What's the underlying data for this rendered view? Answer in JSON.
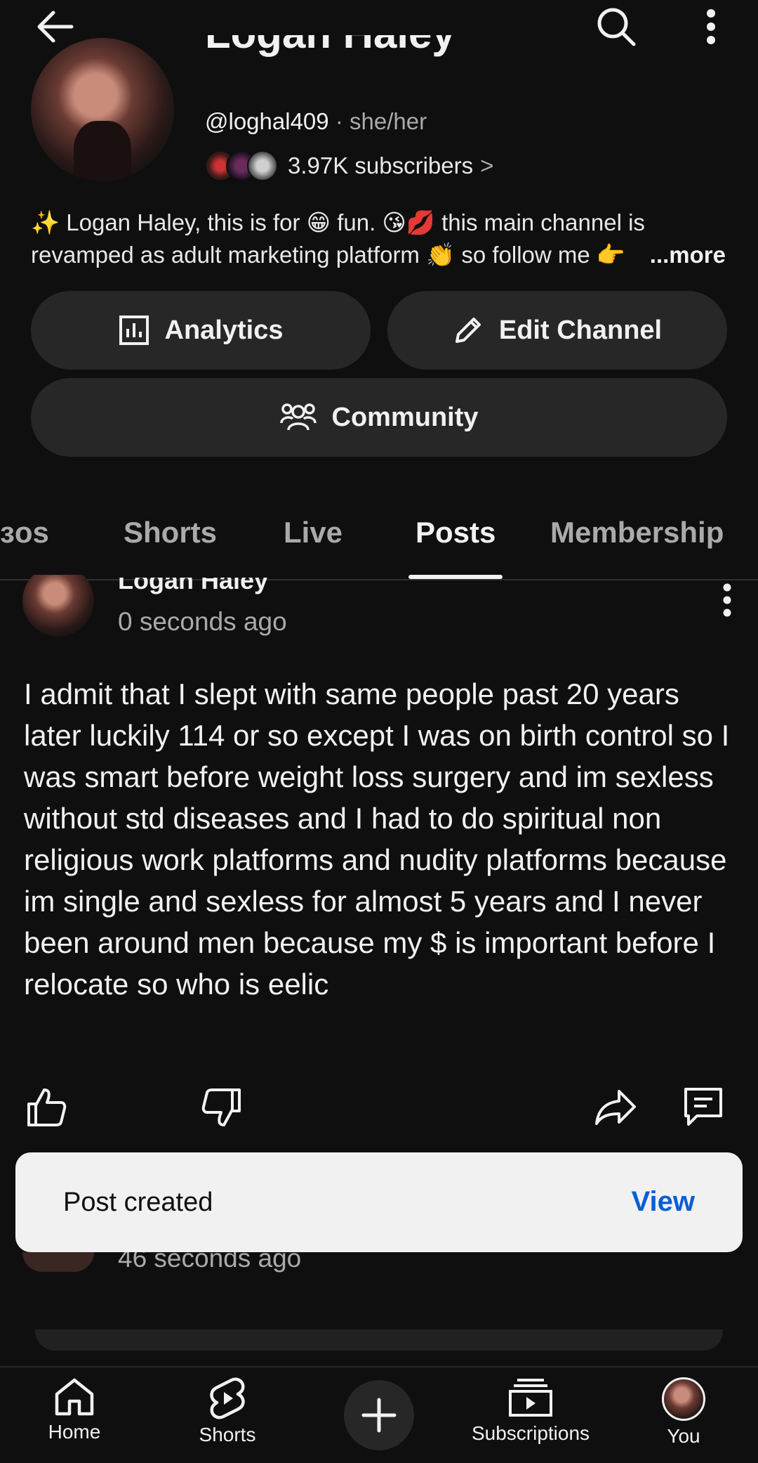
{
  "channel": {
    "name": "Logan Haley",
    "handle": "@loghal409",
    "separator": "·",
    "pronouns": "she/her",
    "subscribers": "3.97K subscribers",
    "subscribers_chevron": ">",
    "description": "✨ Logan Haley, this is for 😁 fun. 😘💋 this main channel is revamped as adult marketing platform 👏 so follow me 👉",
    "more_label": "...more"
  },
  "actions": {
    "analytics_label": "Analytics",
    "edit_label": "Edit Channel",
    "community_label": "Community"
  },
  "tabs": [
    {
      "label": "ɜos"
    },
    {
      "label": "Shorts"
    },
    {
      "label": "Live"
    },
    {
      "label": "Posts",
      "active": true
    },
    {
      "label": "Membership"
    }
  ],
  "post": {
    "author": "Logan Haley",
    "time": "0 seconds ago",
    "body": "I admit that I slept with same people past 20 years later luckily 114 or so except I was on birth control so I was smart before weight loss surgery and im sexless without std diseases and I had to do spiritual non religious work platforms and nudity platforms because im single and sexless for almost 5 years and I never been around men because my $ is important before I relocate so who is eelic"
  },
  "toast": {
    "message": "Post created",
    "action": "View"
  },
  "second_post": {
    "time": "46 seconds ago"
  },
  "bottom_nav": {
    "home": "Home",
    "shorts": "Shorts",
    "subscriptions": "Subscriptions",
    "you": "You"
  },
  "colors": {
    "background": "#0f0f0f",
    "pill": "#272727",
    "link_blue": "#065fd4",
    "secondary_text": "#aaaaaa"
  },
  "icons": [
    "back-arrow-icon",
    "search-icon",
    "more-vert-icon",
    "analytics-icon",
    "pencil-icon",
    "community-icon",
    "like-icon",
    "dislike-icon",
    "share-icon",
    "comment-icon",
    "home-icon",
    "shorts-icon",
    "create-icon",
    "subscriptions-icon"
  ]
}
